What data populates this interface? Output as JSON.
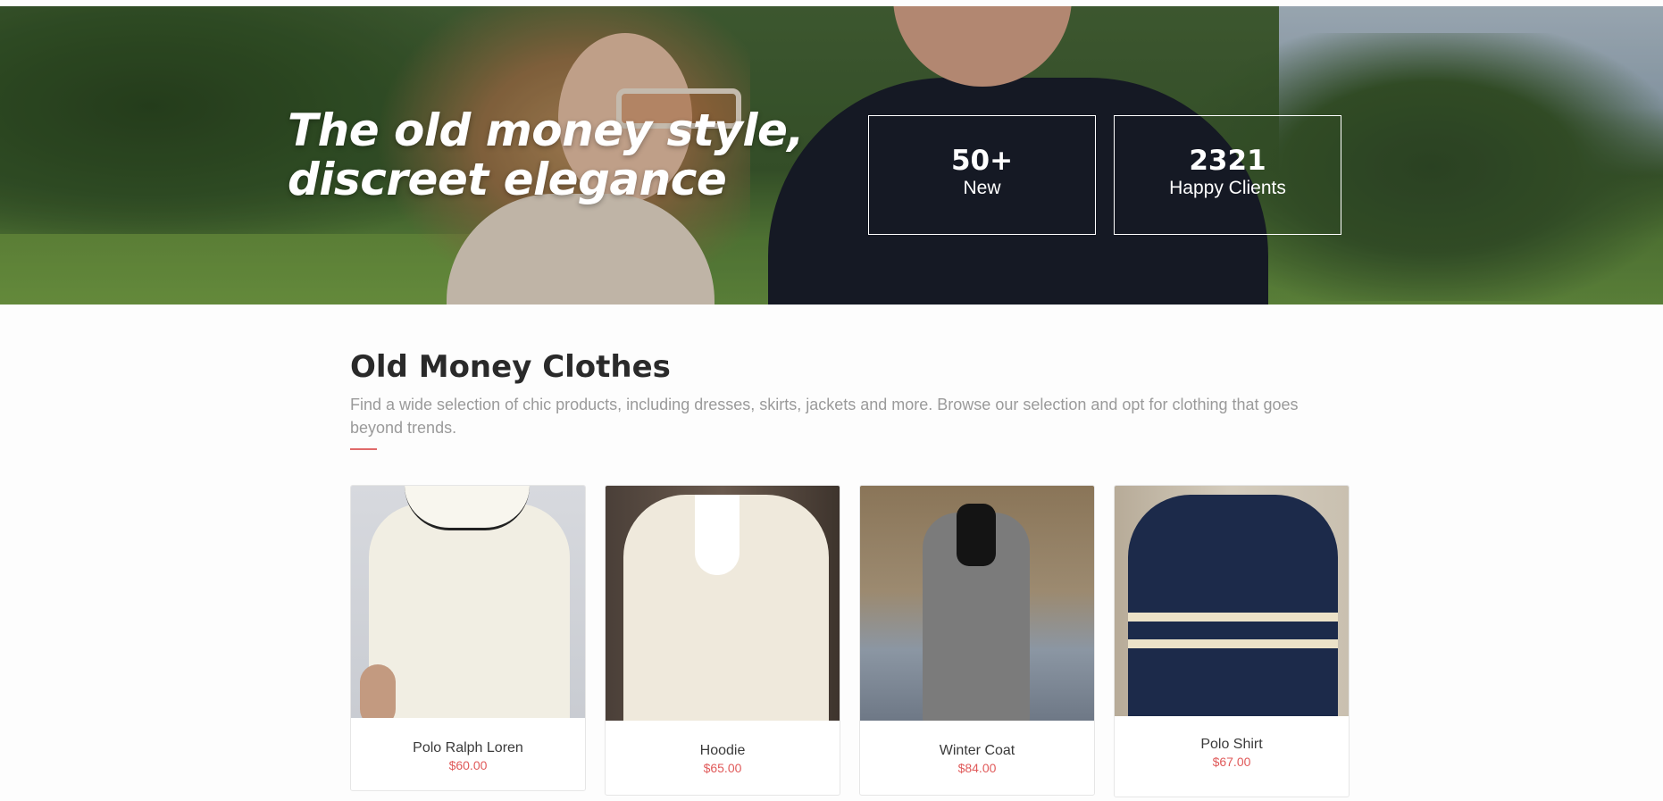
{
  "hero": {
    "title_line1": "The old money style,",
    "title_line2": "discreet elegance",
    "stats": [
      {
        "value": "50+",
        "label": "New"
      },
      {
        "value": "2321",
        "label": "Happy Clients"
      }
    ]
  },
  "section": {
    "title": "Old Money Clothes",
    "description": "Find a wide selection of chic products, including dresses, skirts, jackets and more. Browse our selection and opt for clothing that goes beyond trends.",
    "accent_color": "#e06a6a"
  },
  "products": [
    {
      "name": "Polo Ralph Loren",
      "price": "$60.00"
    },
    {
      "name": "Hoodie",
      "price": "$65.00"
    },
    {
      "name": "Winter Coat",
      "price": "$84.00"
    },
    {
      "name": "Polo Shirt",
      "price": "$67.00"
    }
  ],
  "colors": {
    "price": "#e05a5a",
    "heading": "#2a2a2a",
    "muted_text": "#9a9a9a"
  }
}
